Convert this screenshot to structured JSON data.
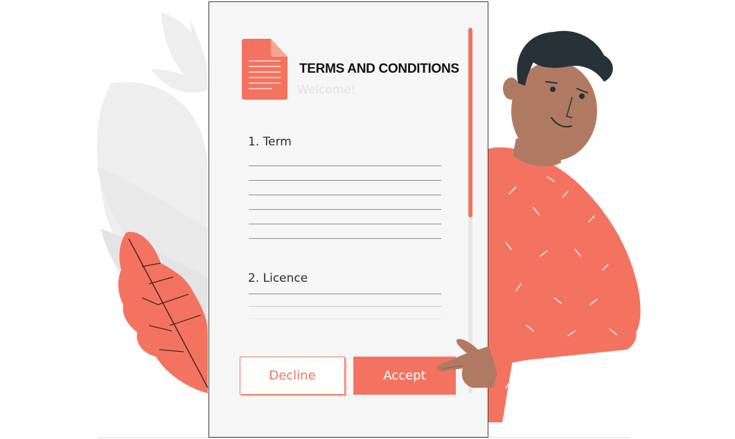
{
  "document": {
    "title": "TERMS AND CONDITIONS",
    "subtitle": "Welcome!",
    "sections": [
      {
        "heading": "1. Term"
      },
      {
        "heading": "2. Licence"
      }
    ]
  },
  "actions": {
    "decline_label": "Decline",
    "accept_label": "Accept"
  },
  "colors": {
    "accent": "#f47360",
    "skin": "#b07a62",
    "hair": "#263238",
    "foliage": "#e8e8e8"
  },
  "icons": {
    "document": "document-icon"
  }
}
